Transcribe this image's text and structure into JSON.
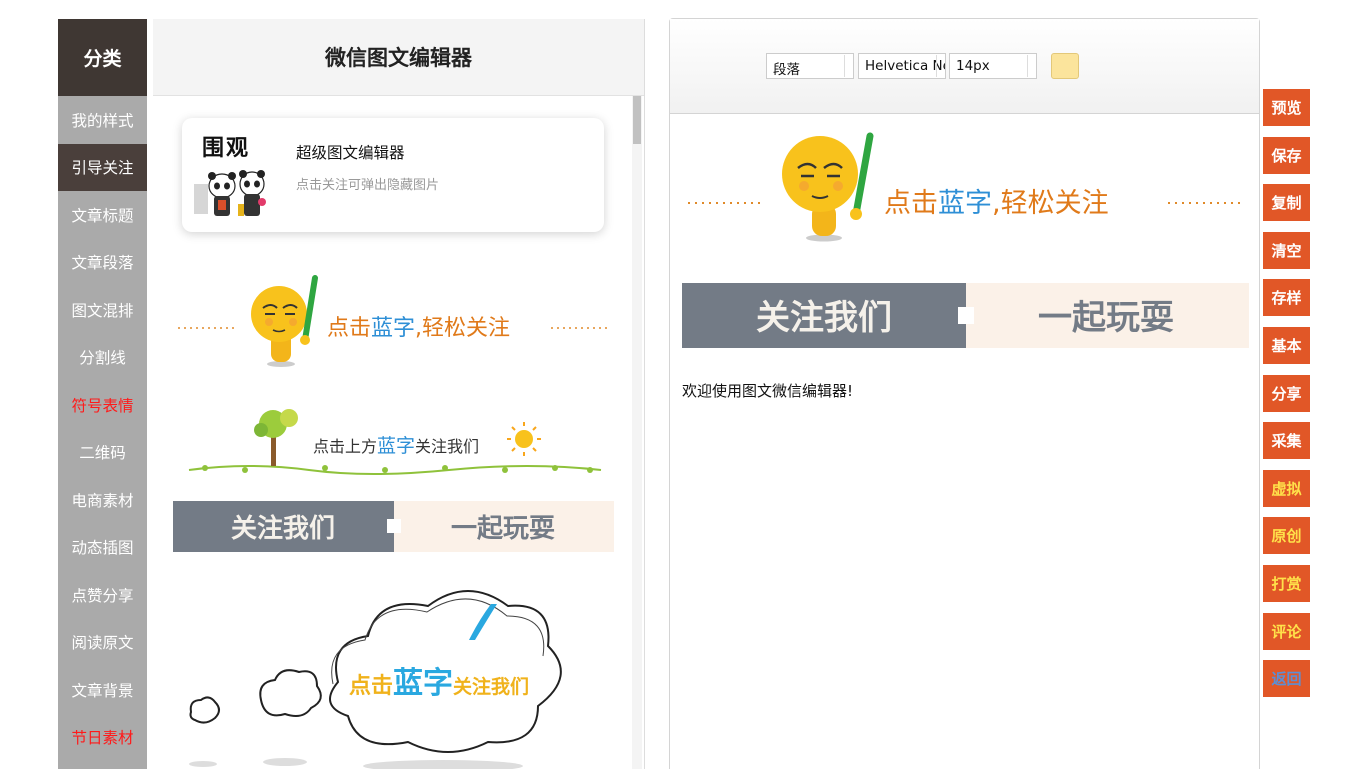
{
  "sidebar": {
    "title": "分类",
    "items": [
      {
        "label": "我的样式"
      },
      {
        "label": "引导关注"
      },
      {
        "label": "文章标题"
      },
      {
        "label": "文章段落"
      },
      {
        "label": "图文混排"
      },
      {
        "label": "分割线"
      },
      {
        "label": "符号表情"
      },
      {
        "label": "二维码"
      },
      {
        "label": "电商素材"
      },
      {
        "label": "动态插图"
      },
      {
        "label": "点赞分享"
      },
      {
        "label": "阅读原文"
      },
      {
        "label": "文章背景"
      },
      {
        "label": "节日素材"
      }
    ],
    "active_index": 1,
    "red_items": [
      "符号表情",
      "节日素材"
    ]
  },
  "templates": {
    "title": "微信图文编辑器",
    "card": {
      "logo": "围观",
      "title": "超级图文编辑器",
      "subtitle": "点击关注可弹出隐藏图片"
    },
    "banner_smiley": {
      "text_a": "点击",
      "text_blue": "蓝字",
      "text_b": ",轻松关注"
    },
    "banner_tree": {
      "text_a": "点击上方",
      "text_blue": "蓝字",
      "text_b": "关注我们"
    },
    "banner_follow": {
      "left": "关注我们",
      "right": "一起玩耍"
    },
    "banner_cloud": {
      "text_a": "点击",
      "text_blue": "蓝字",
      "text_b": "关注我们"
    }
  },
  "editor": {
    "toolbar": {
      "paragraph": "段落",
      "font": "Helvetica Neue",
      "size": "14px",
      "color": "#fbe49c"
    },
    "content": {
      "banner_smiley": {
        "text_a": "点击",
        "text_blue": "蓝字",
        "text_b": ",轻松关注"
      },
      "banner_follow": {
        "left": "关注我们",
        "right": "一起玩耍"
      },
      "welcome": "欢迎使用图文微信编辑器!"
    }
  },
  "actions": [
    {
      "label": "预览"
    },
    {
      "label": "保存"
    },
    {
      "label": "复制"
    },
    {
      "label": "清空"
    },
    {
      "label": "存样"
    },
    {
      "label": "基本"
    },
    {
      "label": "分享"
    },
    {
      "label": "采集"
    },
    {
      "label": "虚拟"
    },
    {
      "label": "原创"
    },
    {
      "label": "打赏"
    },
    {
      "label": "评论"
    },
    {
      "label": "返回"
    }
  ],
  "colors": {
    "accent": "#e15727",
    "sidebar_bg": "#aaaaaa",
    "sidebar_dark": "#3f3733",
    "highlight_yellow": "#ffe14a",
    "return_blue": "#5b8fd6",
    "brand_blue": "#2e8fd6",
    "text_orange": "#e07a1a"
  }
}
